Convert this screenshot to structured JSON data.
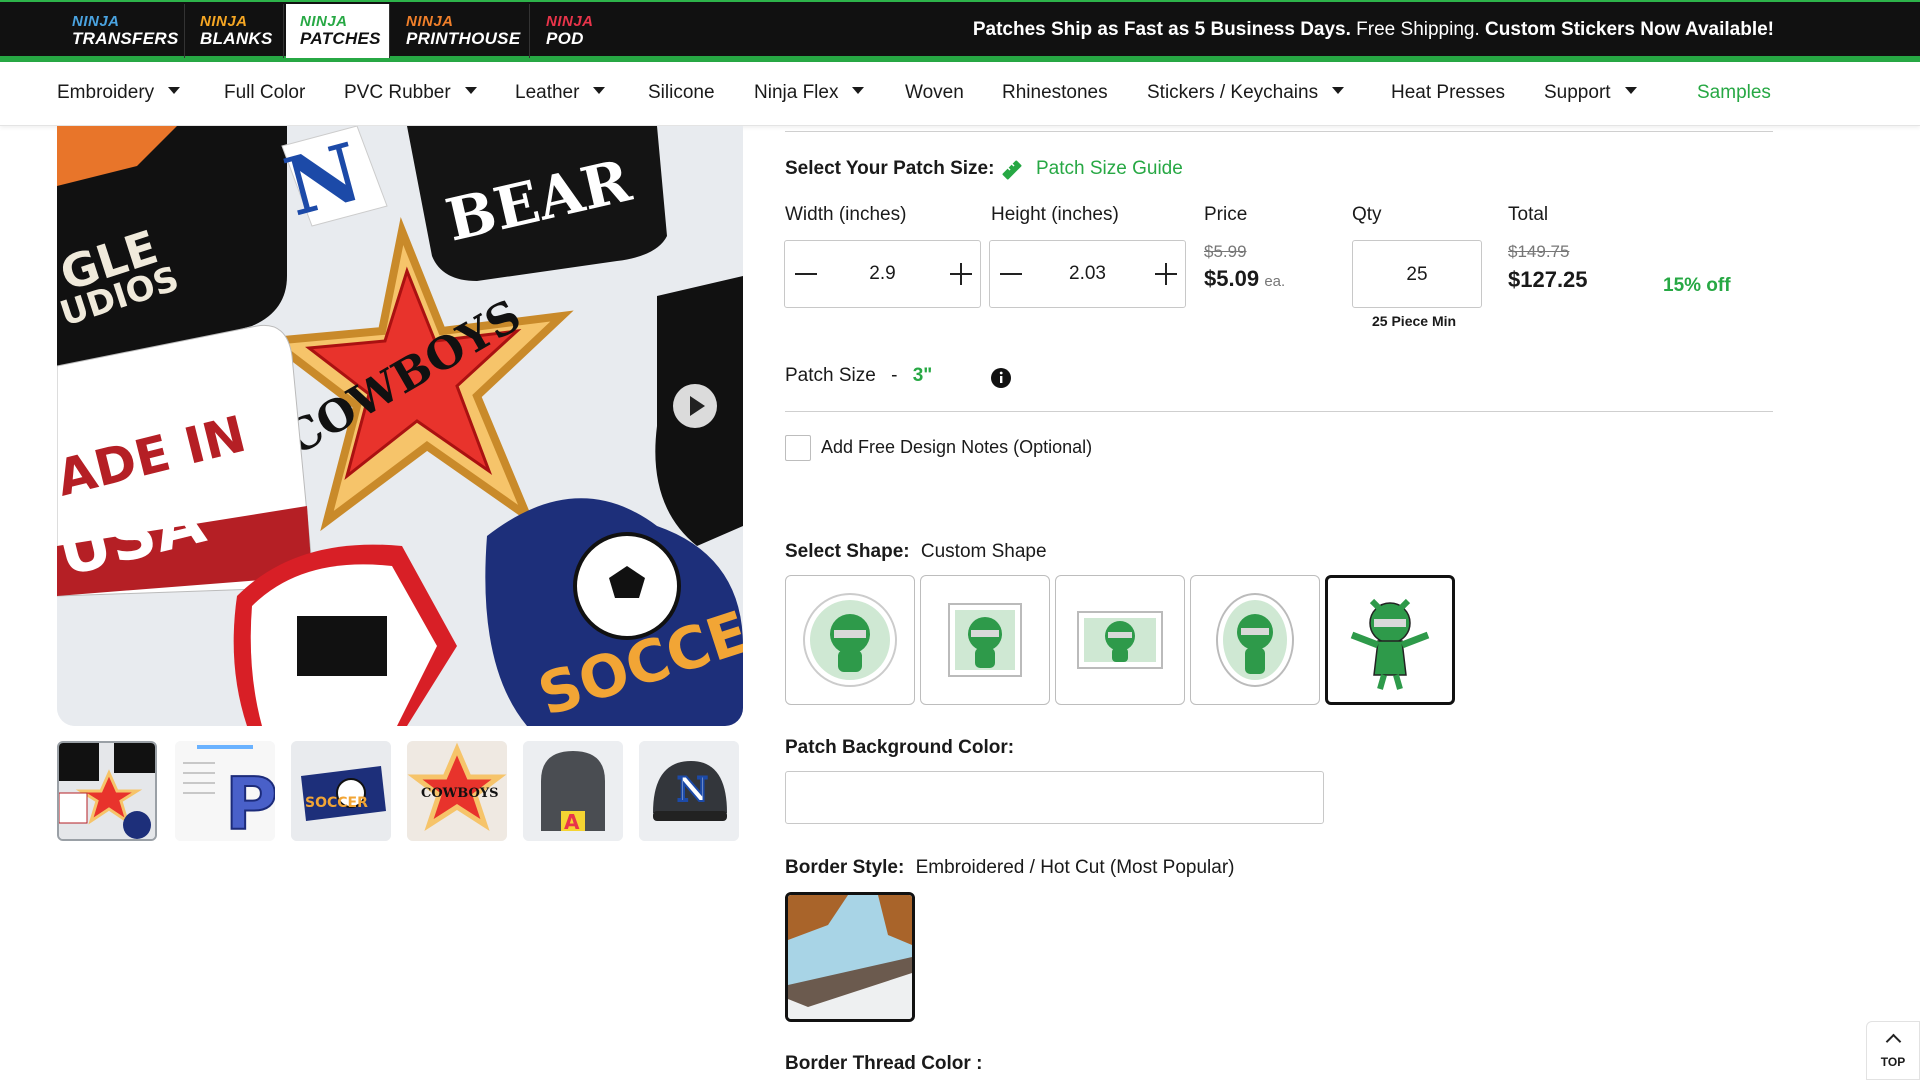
{
  "brands": [
    {
      "ninja": "NINJA",
      "name": "TRANSFERS",
      "color": "#4aa3e0"
    },
    {
      "ninja": "NINJA",
      "name": "BLANKS",
      "color": "#f5a623"
    },
    {
      "ninja": "NINJA",
      "name": "PATCHES",
      "color": "#27a844"
    },
    {
      "ninja": "NINJA",
      "name": "PRINTHOUSE",
      "color": "#f07f2a"
    },
    {
      "ninja": "NINJA",
      "name": "POD",
      "color": "#e8344a"
    }
  ],
  "announcement": {
    "bold1": "Patches Ship as Fast as 5 Business Days.",
    "normal": " Free Shipping. ",
    "bold2": "Custom Stickers Now Available!"
  },
  "nav": {
    "items": [
      "Embroidery",
      "Full Color",
      "PVC Rubber",
      "Leather",
      "Silicone",
      "Ninja Flex",
      "Woven",
      "Rhinestones",
      "Stickers / Keychains",
      "Heat Presses",
      "Support",
      "Samples"
    ]
  },
  "gallery": {
    "main_texts": {
      "bear": "BEAR",
      "cowboys": "COWBOYS",
      "gle": "GLE",
      "udios": "UDIOS",
      "made_in": "ADE IN",
      "usa": "USA",
      "soccer": "SOCCER",
      "n": "N"
    },
    "thumb_letters": {
      "p": "P",
      "a": "A",
      "n": "N",
      "soccer": "SOCCER",
      "cowboys": "COWBOYS"
    }
  },
  "form": {
    "size_label": "Select Your Patch Size:",
    "size_guide": "Patch Size Guide",
    "headers": {
      "width": "Width (inches)",
      "height": "Height (inches)",
      "price": "Price",
      "qty": "Qty",
      "total": "Total"
    },
    "width_value": "2.9",
    "height_value": "2.03",
    "price_old": "$5.99",
    "price_new": "$5.09",
    "price_unit": "ea.",
    "qty_value": "25",
    "qty_min": "25 Piece Min",
    "total_old": "$149.75",
    "total_new": "$127.25",
    "discount": "15% off",
    "patch_size_label": "Patch Size",
    "patch_size_dash": "-",
    "patch_size_value": "3\"",
    "design_notes": "Add Free Design Notes (Optional)",
    "shape_label": "Select Shape:",
    "shape_value": "Custom Shape",
    "bg_color_label": "Patch Background Color:",
    "border_style_label": "Border Style:",
    "border_style_value": "Embroidered / Hot Cut (Most Popular)",
    "border_thread_label": "Border Thread Color :"
  },
  "top_button": "TOP",
  "colors": {
    "accent": "#27a844",
    "dark": "#111111"
  }
}
